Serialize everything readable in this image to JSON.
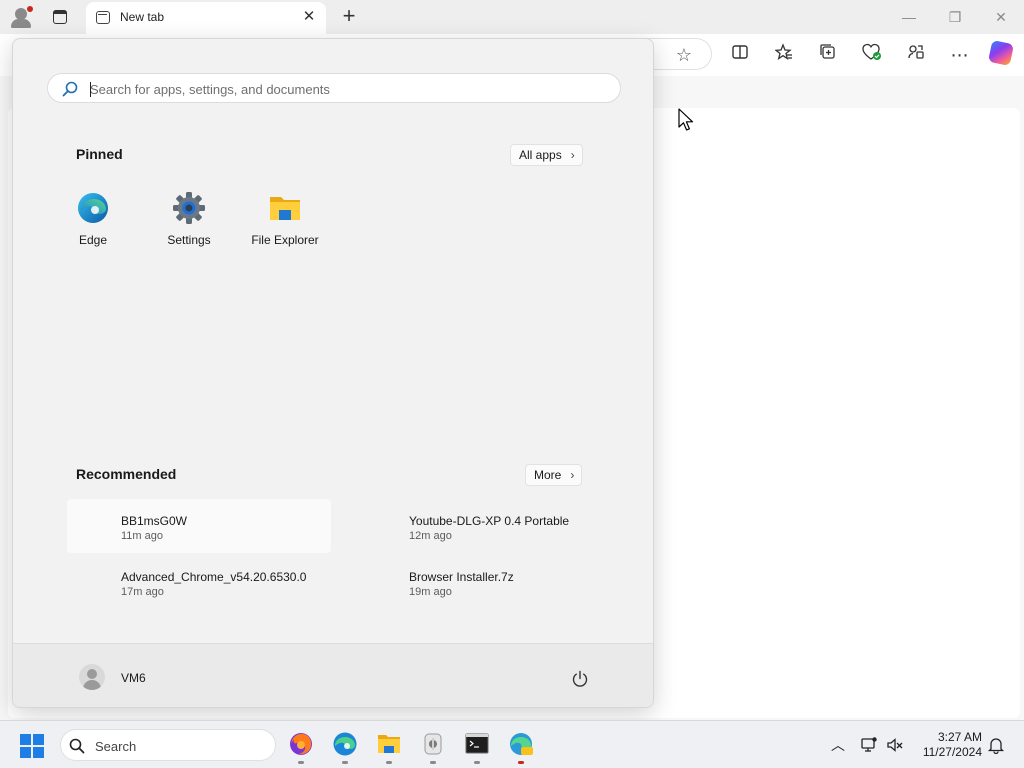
{
  "browser": {
    "tab_title": "New tab",
    "tab_close_glyph": "✕",
    "new_tab_glyph": "+",
    "window_controls": {
      "minimize": "—",
      "restore": "❐",
      "close": "✕"
    },
    "toolbar_icons": [
      "favorite-star-icon",
      "split-screen-icon",
      "favorites-icon",
      "collections-icon",
      "browser-essentials-icon",
      "share-icon",
      "more-menu-icon",
      "copilot-icon"
    ]
  },
  "start_menu": {
    "search_placeholder": "Search for apps, settings, and documents",
    "pinned": {
      "title": "Pinned",
      "all_apps_label": "All apps",
      "apps": [
        {
          "label": "Edge",
          "icon": "edge-icon"
        },
        {
          "label": "Settings",
          "icon": "settings-gear-icon"
        },
        {
          "label": "File Explorer",
          "icon": "folder-icon"
        }
      ]
    },
    "recommended": {
      "title": "Recommended",
      "more_label": "More",
      "items": [
        {
          "name": "BB1msG0W",
          "time": "11m ago"
        },
        {
          "name": "Youtube-DLG-XP 0.4 Portable",
          "time": "12m ago"
        },
        {
          "name": "Advanced_Chrome_v54.20.6530.0",
          "time": "17m ago"
        },
        {
          "name": "Browser Installer.7z",
          "time": "19m ago"
        }
      ]
    },
    "user": {
      "name": "VM6"
    }
  },
  "taskbar": {
    "search_label": "Search",
    "pinned_apps": [
      "firefox-icon",
      "edge-icon",
      "file-explorer-icon",
      "app-icon",
      "terminal-icon",
      "edge-canary-icon"
    ],
    "clock": {
      "time": "3:27 AM",
      "date": "11/27/2024"
    }
  },
  "colors": {
    "accent": "#1f7de6",
    "recording_dot": "#c42b1c"
  }
}
